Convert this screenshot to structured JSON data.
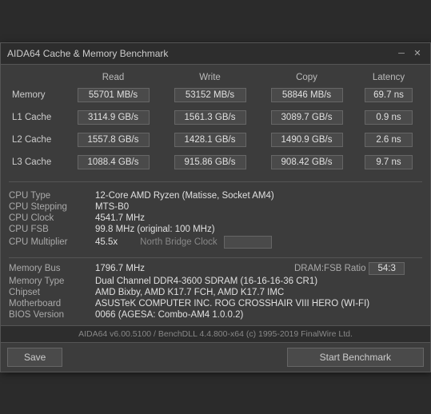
{
  "window": {
    "title": "AIDA64 Cache & Memory Benchmark",
    "minimize_label": "─",
    "close_label": "✕"
  },
  "table_headers": {
    "col1": "",
    "read": "Read",
    "write": "Write",
    "copy": "Copy",
    "latency": "Latency"
  },
  "rows": [
    {
      "label": "Memory",
      "read": "55701 MB/s",
      "write": "53152 MB/s",
      "copy": "58846 MB/s",
      "latency": "69.7 ns"
    },
    {
      "label": "L1 Cache",
      "read": "3114.9 GB/s",
      "write": "1561.3 GB/s",
      "copy": "3089.7 GB/s",
      "latency": "0.9 ns"
    },
    {
      "label": "L2 Cache",
      "read": "1557.8 GB/s",
      "write": "1428.1 GB/s",
      "copy": "1490.9 GB/s",
      "latency": "2.6 ns"
    },
    {
      "label": "L3 Cache",
      "read": "1088.4 GB/s",
      "write": "915.86 GB/s",
      "copy": "908.42 GB/s",
      "latency": "9.7 ns"
    }
  ],
  "cpu_info": {
    "cpu_type_label": "CPU Type",
    "cpu_type_value": "12-Core AMD Ryzen  (Matisse, Socket AM4)",
    "cpu_stepping_label": "CPU Stepping",
    "cpu_stepping_value": "MTS-B0",
    "cpu_clock_label": "CPU Clock",
    "cpu_clock_value": "4541.7 MHz",
    "cpu_fsb_label": "CPU FSB",
    "cpu_fsb_value": "99.8 MHz  (original: 100 MHz)",
    "cpu_multiplier_label": "CPU Multiplier",
    "cpu_multiplier_value": "45.5x",
    "north_bridge_label": "North Bridge Clock",
    "north_bridge_value": ""
  },
  "memory_info": {
    "memory_bus_label": "Memory Bus",
    "memory_bus_value": "1796.7 MHz",
    "dram_fsb_label": "DRAM:FSB Ratio",
    "dram_fsb_value": "54:3",
    "memory_type_label": "Memory Type",
    "memory_type_value": "Dual Channel DDR4-3600 SDRAM  (16-16-16-36 CR1)",
    "chipset_label": "Chipset",
    "chipset_value": "AMD Bixby, AMD K17.7 FCH, AMD K17.7 IMC",
    "motherboard_label": "Motherboard",
    "motherboard_value": "ASUSTeK COMPUTER INC. ROG CROSSHAIR VIII HERO (WI-FI)",
    "bios_label": "BIOS Version",
    "bios_value": "0066  (AGESA: Combo-AM4 1.0.0.2)"
  },
  "status_bar": {
    "text": "AIDA64 v6.00.5100 / BenchDLL 4.4.800-x64  (c) 1995-2019 FinalWire Ltd."
  },
  "buttons": {
    "save": "Save",
    "start_benchmark": "Start Benchmark"
  }
}
